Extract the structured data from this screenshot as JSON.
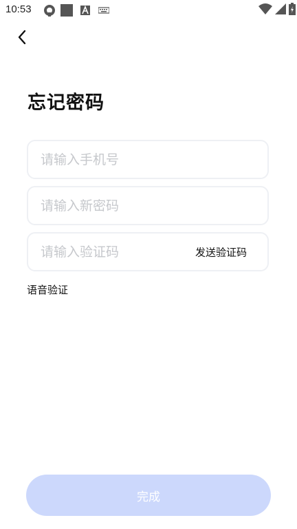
{
  "status_bar": {
    "time": "10:53"
  },
  "header": {
    "title": "忘记密码"
  },
  "form": {
    "phone_placeholder": "请输入手机号",
    "password_placeholder": "请输入新密码",
    "code_placeholder": "请输入验证码",
    "send_code_label": "发送验证码",
    "voice_verify_label": "语音验证"
  },
  "actions": {
    "done_label": "完成"
  },
  "colors": {
    "done_button_bg": "#ccd8fc",
    "field_border": "#eef0f4",
    "placeholder": "#c6c8cc"
  }
}
